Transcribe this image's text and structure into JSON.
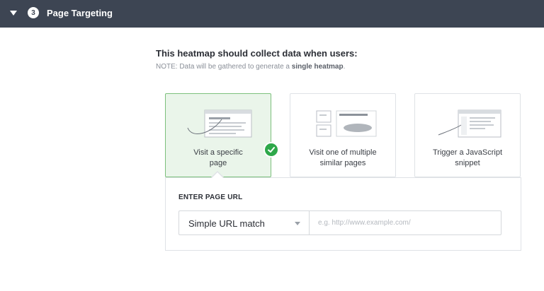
{
  "header": {
    "step": "3",
    "title": "Page Targeting"
  },
  "main": {
    "lead": "This heatmap should collect data when users:",
    "note_prefix": "NOTE: Data will be gathered to generate a ",
    "note_bold": "single heatmap",
    "note_suffix": "."
  },
  "options": [
    {
      "line1": "Visit a specific",
      "line2": "page",
      "selected": true
    },
    {
      "line1": "Visit one of multiple",
      "line2": "similar pages",
      "selected": false
    },
    {
      "line1": "Trigger a JavaScript",
      "line2": "snippet",
      "selected": false
    }
  ],
  "url_panel": {
    "label": "ENTER PAGE URL",
    "match_type": "Simple URL match",
    "url_placeholder": "e.g. http://www.example.com/",
    "url_value": ""
  },
  "colors": {
    "header_bg": "#3d4553",
    "selected_bg": "#eaf5ea",
    "check_green": "#2ea84a"
  }
}
